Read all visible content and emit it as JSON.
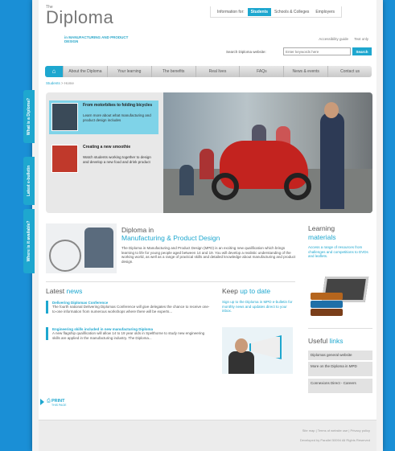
{
  "header": {
    "logo_small": "The",
    "logo": "Diploma",
    "logo_sub": "in MANUFACTURING AND PRODUCT DESIGN",
    "audience_label": "Information for:",
    "audience": [
      "Students",
      "Schools & Colleges",
      "Employers"
    ],
    "util_links": [
      "Accessibility guide",
      "Text only"
    ],
    "search_label": "Search Diploma website:",
    "search_placeholder": "Enter keywords here",
    "search_button": "Search"
  },
  "nav": {
    "home_icon": "house-icon",
    "items": [
      "About the Diploma",
      "Your learning",
      "The benefits",
      "Real lives",
      "FAQs",
      "News & events",
      "Contact us"
    ]
  },
  "breadcrumb": {
    "link": "Students",
    "current": "Home"
  },
  "hero": {
    "features": [
      {
        "title": "From motorbikes to folding bicycles",
        "desc": "Learn more about what manufacturing and product design includes"
      },
      {
        "title": "Creating a new smoothie",
        "desc": "Watch students working together to design and develop a new food and drink product"
      }
    ]
  },
  "side_tabs": [
    "What is a Diploma?",
    "Latest e-bulletin",
    "Where is it available?"
  ],
  "diploma": {
    "title1": "Diploma in",
    "title2": "Manufacturing & Product Design",
    "text": "The Diploma in Manufacturing and Product Design (MPD) is an exciting new qualification which brings learning to life for young people aged between 14 and 19. You will develop a realistic understanding of the working world, as well as a range of practical skills and detailed knowledge about manufacturing and product design."
  },
  "learning": {
    "title1": "Learning",
    "title2": "materials",
    "text": "Access a range of resources from challenges and competitions to DVDs and leaflets."
  },
  "news": {
    "title1": "Latest",
    "title2": "news",
    "items": [
      {
        "title": "Delivering Diplomas Conference",
        "desc": "The fourth national Delivering Diplomas Conference will give delegates the chance to receive one-to-one information from numerous workshops where there will be experts..."
      },
      {
        "title": "Engineering skills included in new manufacturing Diploma",
        "desc": "A new flagship qualification will allow 14 to 19 year olds in Spelthorne to study new engineering skills are applied in the manufacturing industry. The Diploma..."
      }
    ]
  },
  "keep": {
    "title1": "Keep",
    "title2": "up to date",
    "text": "Sign up to the Diploma in MPD e-bulletin for monthly news and updates direct to your inbox."
  },
  "useful": {
    "title1": "Useful",
    "title2": "links",
    "items": [
      "Diplomas general website",
      "More on the Diploma in MPD",
      "Connexions Direct - Careers"
    ]
  },
  "print": {
    "label": "PRINT",
    "sub": "THIS PAGE"
  },
  "footer": {
    "links": "Site map | Terms of website use | Privacy policy",
    "credit": "Developed by Parallel 50094 All Rights Reserved"
  }
}
